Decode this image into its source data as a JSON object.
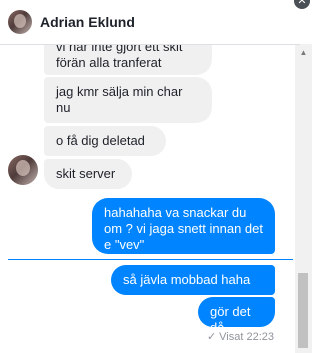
{
  "header": {
    "name": "Adrian Eklund"
  },
  "messages": [
    {
      "text": "vi har inte gjort ett skit förän alla tranferat"
    },
    {
      "text": "jag kmr sälja min char nu"
    },
    {
      "text": "o få dig deletad"
    },
    {
      "text": "skit server"
    },
    {
      "text": "hahahaha va snackar du om ? vi jaga snett innan det e \"vev\""
    },
    {
      "text": "så jävla mobbad haha"
    },
    {
      "text": "gör det då"
    }
  ],
  "status": {
    "seen": "Visat 22:23"
  },
  "icons": {
    "close": "close-icon",
    "check": "check-icon",
    "scroll_up": "scroll-up-icon"
  },
  "colors": {
    "outgoing": "#0084ff",
    "incoming": "#f1f0f0"
  }
}
